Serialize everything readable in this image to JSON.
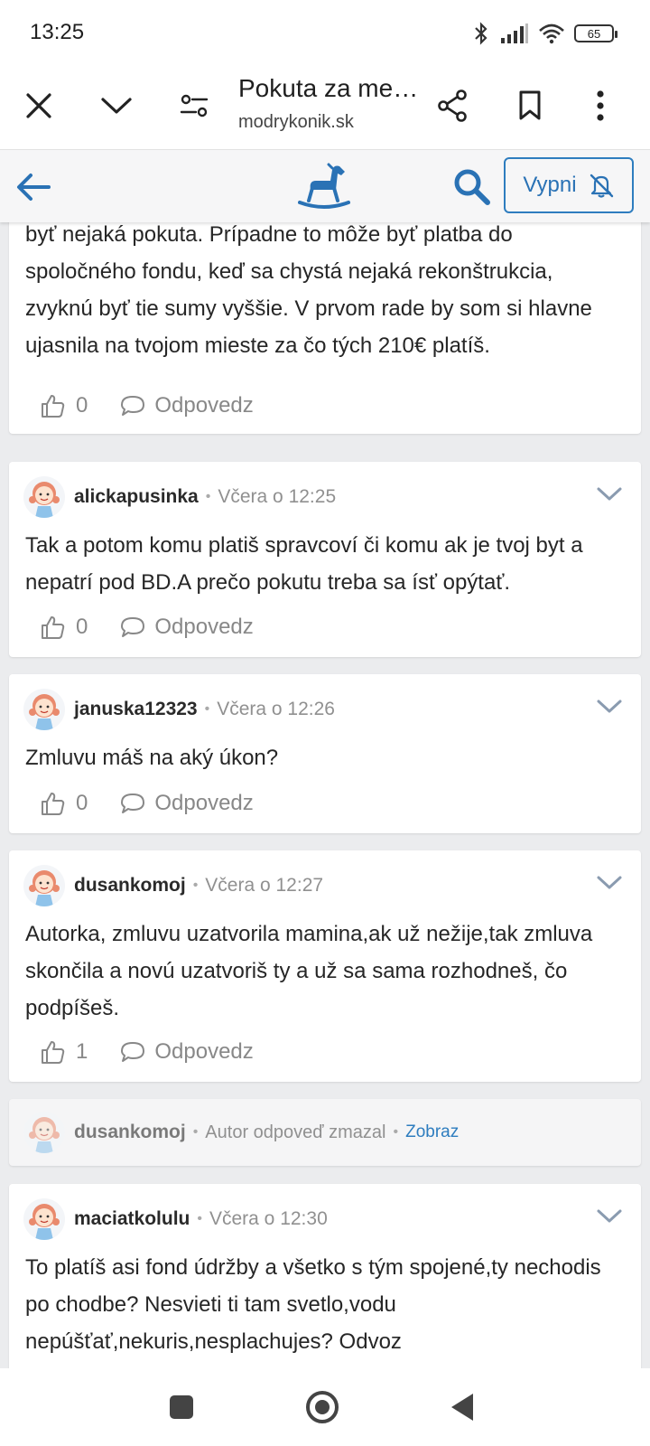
{
  "status_bar": {
    "time": "13:25",
    "battery": "65"
  },
  "browser": {
    "page_title": "Pokuta za me…",
    "domain": "modrykonik.sk"
  },
  "site_header": {
    "notify_button_label": "Vypni"
  },
  "comments": [
    {
      "partial": true,
      "text": "podobné? V takom prípade si viem predstaviť že tam môže byť nejaká pokuta. Prípadne to môže byť platba do spoločného fondu, keď sa chystá nejaká rekonštrukcia, zvyknú byť tie sumy vyššie. V prvom rade by som si hlavne ujasnila na tvojom mieste za čo tých 210€ platíš.",
      "likes": "0",
      "reply_label": "Odpovedz"
    },
    {
      "username": "alickapusinka",
      "time": "Včera o 12:25",
      "text": "Tak a potom komu platiš spravcoví či komu ak je tvoj byt a nepatrí pod BD.A prečo pokutu treba sa ísť opýtať.",
      "likes": "0",
      "reply_label": "Odpovedz"
    },
    {
      "username": "januska12323",
      "time": "Včera o 12:26",
      "text": "Zmluvu máš na aký úkon?",
      "likes": "0",
      "reply_label": "Odpovedz"
    },
    {
      "username": "dusankomoj",
      "time": "Včera o 12:27",
      "text": "Autorka, zmluvu uzatvorila mamina,ak už nežije,tak zmluva skončila a novú uzatvoriš ty a už sa sama rozhodneš, čo podpíšeš.",
      "likes": "1",
      "reply_label": "Odpovedz"
    },
    {
      "username": "dusankomoj",
      "deleted": true,
      "status": "Autor odpoveď zmazal",
      "show_label": "Zobraz"
    },
    {
      "username": "maciatkolulu",
      "time": "Včera o 12:30",
      "text": "To platíš asi fond údržby a všetko s tým spojené,ty nechodis po chodbe? Nesvieti ti tam svetlo,vodu nepúšťať,nekuris,nesplachujes? Odvoz"
    }
  ]
}
